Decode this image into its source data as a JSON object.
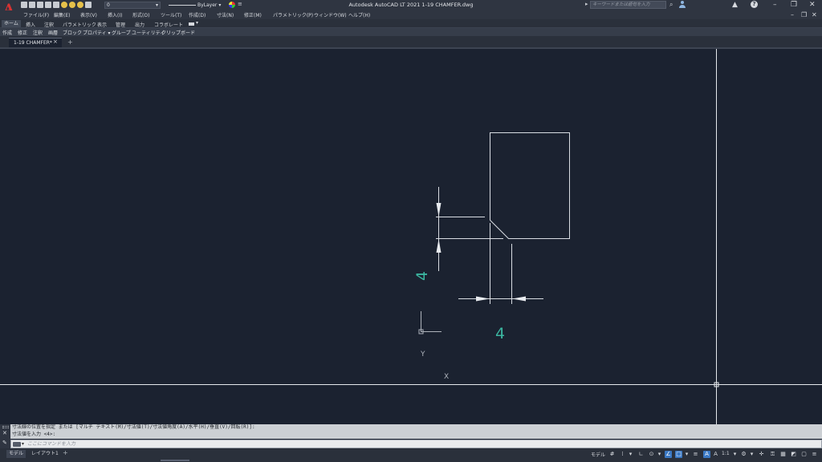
{
  "app": {
    "title": "Autodesk AutoCAD LT 2021    1-19 CHAMFER.dwg",
    "logo": "A"
  },
  "qat": {
    "layer_value": "0",
    "linetype_value": "ByLayer",
    "search_placeholder": "キーワードまたは語句を入力"
  },
  "menu": {
    "items": [
      "ファイル(F)",
      "編集(E)",
      "表示(V)",
      "挿入(I)",
      "形式(O)",
      "ツール(T)",
      "作成(D)",
      "寸法(N)",
      "修正(M)",
      "パラメトリック(P)",
      "ウィンドウ(W)",
      "ヘルプ(H)"
    ]
  },
  "ribbon": {
    "tabs": [
      "ホーム",
      "挿入",
      "注釈",
      "パラメトリック",
      "表示",
      "管理",
      "出力",
      "コラボレート"
    ],
    "panels": [
      "作成",
      "修正",
      "注釈",
      "画層",
      "ブロック",
      "プロパティ ▾",
      "グループ",
      "ユーティリティ",
      "クリップボード"
    ]
  },
  "file_tabs": {
    "active": "1-19 CHAMFER*",
    "close": "×",
    "new": "+"
  },
  "drawing": {
    "dimension_vertical": "4",
    "dimension_horizontal": "4",
    "ucs_x": "X",
    "ucs_y": "Y",
    "line_color": "#d9dde3",
    "dim_color": "#3bb6a0"
  },
  "command": {
    "history_line1": "寸法線の位置を指定 または [マルチ テキスト(M)/寸法値(T)/寸法値角度(A)/水平(H)/垂直(V)/回転(R)]:",
    "history_line2": "寸法値を入力 <4>:",
    "input_placeholder": "ここにコマンドを入力"
  },
  "status": {
    "layout_tabs": [
      "モデル",
      "レイアウト1"
    ],
    "model_label": "モデル",
    "scale": "1:1"
  }
}
